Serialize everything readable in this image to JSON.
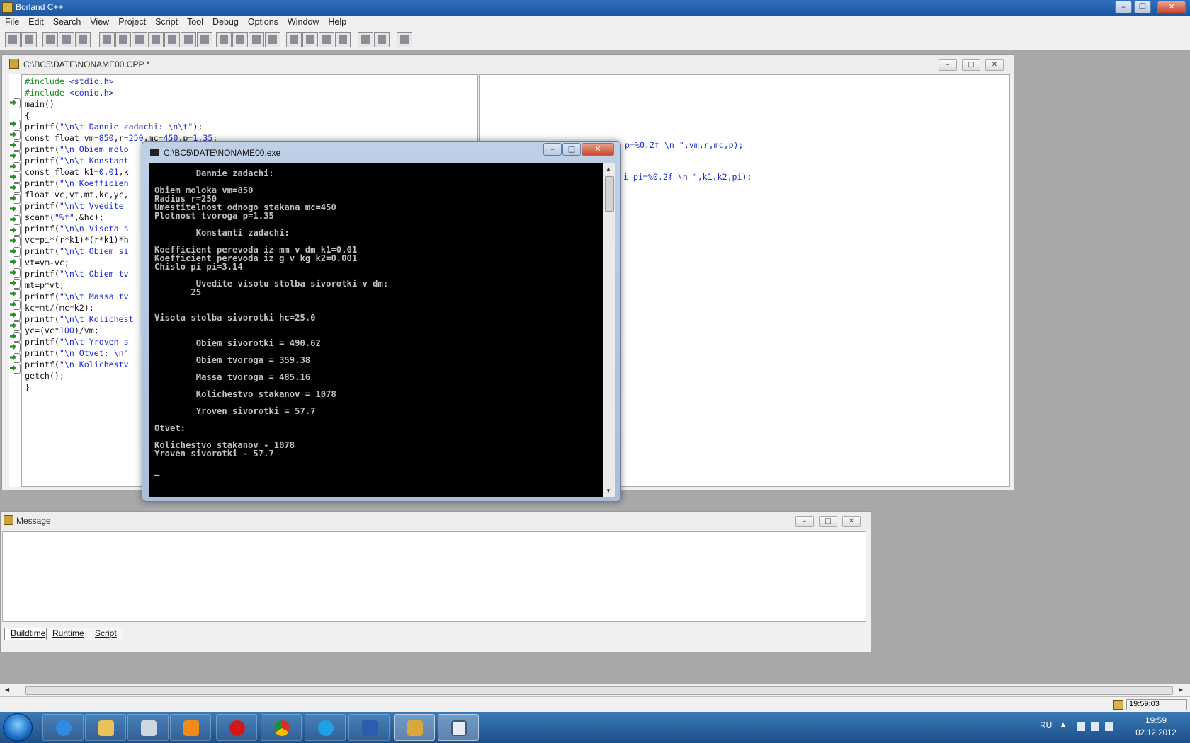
{
  "app": {
    "title": "Borland C++"
  },
  "menu": [
    "File",
    "Edit",
    "Search",
    "View",
    "Project",
    "Script",
    "Tool",
    "Debug",
    "Options",
    "Window",
    "Help"
  ],
  "editor": {
    "title": "C:\\BC5\\DATE\\NONAME00.CPP *",
    "right_fragments": [
      "p=%0.2f \\n \",vm,r,mc,p);",
      "i pi=%0.2f \\n \",k1,k2,pi);"
    ]
  },
  "console": {
    "title": "C:\\BC5\\DATE\\NONAME00.exe",
    "lines": [
      "        Dannie zadachi:",
      "",
      "Obiem moloka vm=850",
      "Radius r=250",
      "Umestitelnost odnogo stakana mc=450",
      "Plotnost tvoroga p=1.35",
      "",
      "        Konstanti zadachi:",
      "",
      "Koefficient perevoda iz mm v dm k1=0.01",
      "Koefficient perevoda iz g v kg k2=0.001",
      "Chislo pi pi=3.14",
      "",
      "        Uvedite visotu stolba sivorotki v dm:",
      "       25",
      "",
      "",
      "Visota stolba sivorotki hc=25.0",
      "",
      "",
      "        Obiem sivorotki = 490.62",
      "",
      "        Obiem tvoroga = 359.38",
      "",
      "        Massa tvoroga = 485.16",
      "",
      "        Kolichestvo stakanov = 1078",
      "",
      "        Yroven sivorotki = 57.7",
      "",
      "Otvet:",
      "",
      "Kolichestvo stakanov - 1078",
      "Yroven sivorotki - 57.7",
      "",
      "_"
    ]
  },
  "message": {
    "title": "Message",
    "tabs": [
      "Buildtime",
      "Runtime",
      "Script"
    ]
  },
  "status": {
    "clock": "19:59:03"
  },
  "tray": {
    "lang": "RU",
    "time": "19:59",
    "date": "02.12.2012"
  }
}
